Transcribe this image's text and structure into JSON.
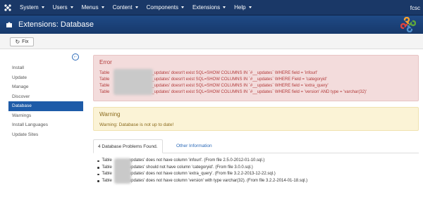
{
  "nav": {
    "items": [
      "System",
      "Users",
      "Menus",
      "Content",
      "Components",
      "Extensions",
      "Help"
    ],
    "site_name": "fcsc"
  },
  "title": "Extensions: Database",
  "toolbar": {
    "fix_label": "Fix"
  },
  "sidebar": {
    "items": [
      {
        "label": "Install",
        "active": false
      },
      {
        "label": "Update",
        "active": false
      },
      {
        "label": "Manage",
        "active": false
      },
      {
        "label": "Discover",
        "active": false
      },
      {
        "label": "Database",
        "active": true
      },
      {
        "label": "Warnings",
        "active": false
      },
      {
        "label": "Install Languages",
        "active": false
      },
      {
        "label": "Update Sites",
        "active": false
      }
    ]
  },
  "error": {
    "heading": "Error",
    "lines": [
      {
        "prefix": "Table",
        "text": "_updates' doesn't exist SQL=SHOW COLUMNS IN `#__updates` WHERE field = 'infourl'"
      },
      {
        "prefix": "Table",
        "text": "_updates' doesn't exist SQL=SHOW COLUMNS IN `#__updates` WHERE Field = 'categoryid'"
      },
      {
        "prefix": "Table",
        "text": "_updates' doesn't exist SQL=SHOW COLUMNS IN `#__updates` WHERE field = 'extra_query'"
      },
      {
        "prefix": "Table",
        "text": "_updates' doesn't exist SQL=SHOW COLUMNS IN `#__updates` WHERE field = 'version' AND type = 'varchar(32)'"
      }
    ]
  },
  "warning": {
    "heading": "Warning",
    "text": "Warning: Database is not up to date!"
  },
  "tabs": {
    "active": "4 Database Problems Found.",
    "other": "Other Information"
  },
  "problems": [
    {
      "prefix": "Table",
      "text": "updates' does not have column 'infourl'. (From file 2.5.0-2012-01-10.sql.)"
    },
    {
      "prefix": "Table",
      "text": "updates' should not have column 'categoryid'. (From file 3.0.0.sql.)"
    },
    {
      "prefix": "Table",
      "text": "updates' does not have column 'extra_query'. (From file 3.2.2-2013-12-22.sql.)"
    },
    {
      "prefix": "Table",
      "text": "updates' does not have column 'version' with type varchar(32). (From file 3.2.2-2014-01-18.sql.)"
    }
  ],
  "colors": {
    "nav_bg": "#1a3867",
    "title_bg": "#1f4a86",
    "sidebar_active": "#1e5ba8",
    "error_bg": "#f3dcdc",
    "error_text": "#b23a3a",
    "warning_bg": "#fbf3d6",
    "warning_text": "#8a6a1c",
    "link": "#2a69b8"
  },
  "icons": {
    "logo": "joomla-logo-icon",
    "title": "puzzle-icon",
    "fix": "refresh-icon",
    "collapse": "circle-left-arrow-icon",
    "brand": "joomla-brand-icon"
  }
}
